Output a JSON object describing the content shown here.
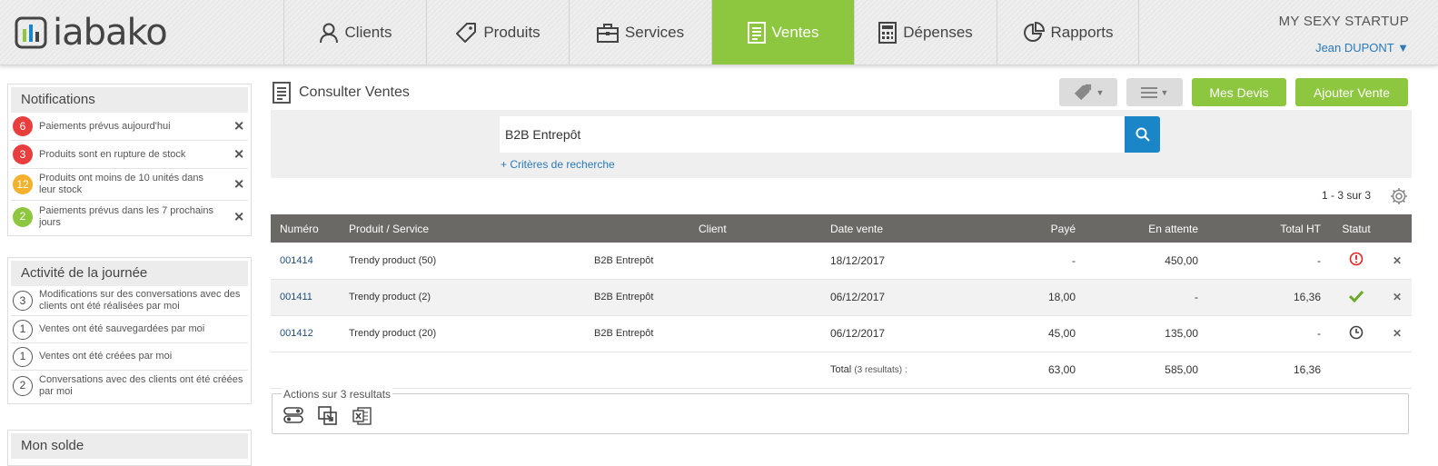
{
  "brand": {
    "name": "iabako"
  },
  "nav": [
    {
      "label": "Clients",
      "icon": "user-icon"
    },
    {
      "label": "Produits",
      "icon": "tag-icon"
    },
    {
      "label": "Services",
      "icon": "briefcase-icon"
    },
    {
      "label": "Ventes",
      "icon": "document-icon",
      "active": true
    },
    {
      "label": "Dépenses",
      "icon": "calculator-icon"
    },
    {
      "label": "Rapports",
      "icon": "pie-chart-icon"
    }
  ],
  "account": {
    "company": "MY SEXY STARTUP",
    "user": "Jean DUPONT ▼"
  },
  "notifications": {
    "title": "Notifications",
    "items": [
      {
        "count": "6",
        "text": "Paiements prévus aujourd'hui",
        "color": "#e83e3e"
      },
      {
        "count": "3",
        "text": "Produits sont en rupture de stock",
        "color": "#e83e3e"
      },
      {
        "count": "12",
        "text": "Produits ont moins de 10 unités dans leur stock",
        "color": "#f4b12b"
      },
      {
        "count": "2",
        "text": "Paiements prévus dans les 7 prochains jours",
        "color": "#8dc63f"
      }
    ]
  },
  "activity": {
    "title": "Activité de la journée",
    "items": [
      {
        "count": "3",
        "text": "Modifications sur des conversations avec des clients ont été réalisées par moi"
      },
      {
        "count": "1",
        "text": "Ventes ont été sauvegardées par moi"
      },
      {
        "count": "1",
        "text": "Ventes ont été créées par moi"
      },
      {
        "count": "2",
        "text": "Conversations avec des clients ont été créées par moi"
      }
    ]
  },
  "balance": {
    "title": "Mon solde"
  },
  "page": {
    "title": "Consulter Ventes"
  },
  "toolbar": {
    "quotes_label": "Mes Devis",
    "add_label": "Ajouter Vente"
  },
  "search": {
    "value": "B2B Entrepôt",
    "criteria": "+ Critères de recherche"
  },
  "pager": {
    "text": "1 - 3 sur 3"
  },
  "table": {
    "headers": [
      "Numéro",
      "Produit / Service",
      "Client",
      "Date vente",
      "Payé",
      "En attente",
      "Total HT",
      "Statut"
    ],
    "rows": [
      {
        "numero": "001414",
        "produit": "Trendy product (50)",
        "client": "B2B Entrepôt",
        "date": "18/12/2017",
        "paye": "-",
        "attente": "450,00",
        "total": "-",
        "status": "alert-icon"
      },
      {
        "numero": "001411",
        "produit": "Trendy product (2)",
        "client": "B2B Entrepôt",
        "date": "06/12/2017",
        "paye": "18,00",
        "attente": "-",
        "total": "16,36",
        "status": "check-icon"
      },
      {
        "numero": "001412",
        "produit": "Trendy product (20)",
        "client": "B2B Entrepôt",
        "date": "06/12/2017",
        "paye": "45,00",
        "attente": "135,00",
        "total": "-",
        "status": "clock-icon"
      }
    ],
    "totals": {
      "label": "Total",
      "sublabel": "(3 resultats) :",
      "paye": "63,00",
      "attente": "585,00",
      "total": "16,36"
    }
  },
  "actions": {
    "label": "Actions sur 3 resultats"
  },
  "colors": {
    "accent": "#8dc63f",
    "link": "#2a7ab8",
    "search": "#1a86c8",
    "alert": "#e02424"
  }
}
